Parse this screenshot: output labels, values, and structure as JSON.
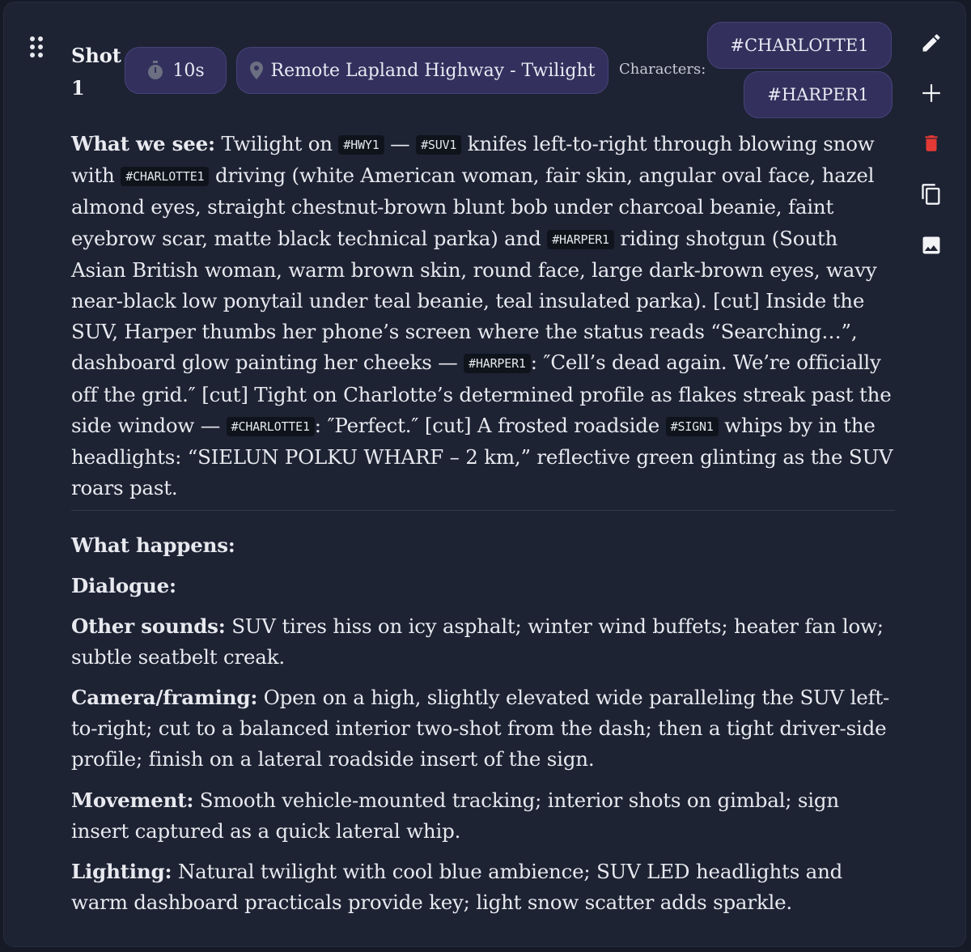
{
  "shot": {
    "title": "Shot 1",
    "duration": "10s",
    "location": "Remote Lapland Highway - Twilight"
  },
  "characters": {
    "label": "Characters:",
    "list": [
      "#CHARLOTTE1",
      "#HARPER1"
    ]
  },
  "actions": {
    "edit": "pencil-icon",
    "add": "plus-icon",
    "delete": "trash-icon",
    "duplicate": "copy-icon",
    "image": "image-icon"
  },
  "description": {
    "label": "What we see:",
    "t1": " Twilight on ",
    "tag_hwy": "#HWY1",
    "t2": " — ",
    "tag_suv": "#SUV1",
    "t3": " knifes left-to-right through blowing snow with ",
    "tag_charlotte": "#CHARLOTTE1",
    "t4": " driving (white American woman, fair skin, angular oval face, hazel almond eyes, straight chestnut-brown blunt bob under charcoal beanie, faint eyebrow scar, matte black technical parka) and ",
    "tag_harper": "#HARPER1",
    "t5": " riding shotgun (South Asian British woman, warm brown skin, round face, large dark-brown eyes, wavy near-black low ponytail under teal beanie, teal insulated parka). [cut] Inside the SUV, Harper thumbs her phone’s screen where the status reads “Searching…”, dashboard glow painting her cheeks — ",
    "tag_harper2": "#HARPER1",
    "t6": ": ″Cell’s dead again. We’re officially off the grid.″ [cut] Tight on Charlotte’s determined profile as flakes streak past the side window — ",
    "tag_charlotte2": "#CHARLOTTE1",
    "t7": ": ″Perfect.″ [cut] A frosted roadside ",
    "tag_sign": "#SIGN1",
    "t8": " whips by in the headlights: “SIELUN POLKU WHARF – 2 km,” reflective green glinting as the SUV roars past."
  },
  "details": {
    "what_happens_label": "What happens:",
    "dialogue_label": "Dialogue:",
    "sounds_label": "Other sounds:",
    "sounds": " SUV tires hiss on icy asphalt; winter wind buffets; heater fan low; subtle seatbelt creak.",
    "camera_label": "Camera/framing:",
    "camera": " Open on a high, slightly elevated wide paralleling the SUV left-to-right; cut to a balanced interior two-shot from the dash; then a tight driver-side profile; finish on a lateral roadside insert of the sign.",
    "movement_label": "Movement:",
    "movement": " Smooth vehicle-mounted tracking; interior shots on gimbal; sign insert captured as a quick lateral whip.",
    "lighting_label": "Lighting:",
    "lighting": " Natural twilight with cool blue ambience; SUV LED headlights and warm dashboard practicals provide key; light snow scatter adds sparkle."
  },
  "colors": {
    "background": "#151a26",
    "card": "#1d2333",
    "pill": "#33305d",
    "delete": "#e53935"
  }
}
